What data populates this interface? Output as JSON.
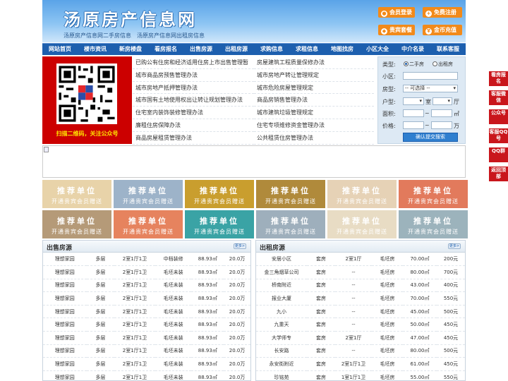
{
  "header": {
    "logo": "汤原房产信息网",
    "subtitle1": "汤原房产信息网二手房信息",
    "subtitle2": "汤原房产信息网出租房信息",
    "buttons": [
      "会员登录",
      "免费注册",
      "贵宾套餐",
      "金币充值"
    ]
  },
  "nav": [
    "网站首页",
    "楼市资讯",
    "新房楼盘",
    "看房报名",
    "出售房源",
    "出租房源",
    "求购信息",
    "求租信息",
    "地图找房",
    "小区大全",
    "中介名录",
    "联系客服"
  ],
  "qr": {
    "caption": "扫描二维码，关注公众号"
  },
  "news": {
    "left": [
      "已购公有住房和经济适用住房上市出售管理暂",
      "城市商品房预售管理办法",
      "城市房地产抵押管理办法",
      "城市国有土地使用权出让转让规划管理办法",
      "住宅室内装饰装修管理办法",
      "廉租住房保障办法",
      "商品房屋租赁管理办法"
    ],
    "right": [
      "房屋建筑工程质量保修办法",
      "城市房地产转让管理规定",
      "城市危险房屋管理规定",
      "商品房销售管理办法",
      "城市建筑垃圾管理规定",
      "住宅专项维修资金管理办法",
      "公共租赁住房管理办法"
    ]
  },
  "search": {
    "type_label": "类型:",
    "type_options": [
      "二手房",
      "出租房"
    ],
    "district_label": "小区:",
    "house_type_label": "房型:",
    "house_type_value": "-- 可选择 --",
    "layout_label": "户型:",
    "layout_unit1": "室",
    "layout_unit2": "厅",
    "area_label": "面积:",
    "range_sep": "~",
    "area_unit": "㎡",
    "price_label": "价格:",
    "price_unit": "万",
    "submit": "确认提交搜索"
  },
  "ads": {
    "title": "推荐单位",
    "sub": "开通贵宾会员赠送",
    "colors": [
      "#e8d3a9",
      "#9db3c9",
      "#c99e2e",
      "#b08a3b",
      "#e6d2b6",
      "#e27a5c",
      "#b59a78",
      "#e6835e",
      "#3aa3a5",
      "#9eafbc",
      "#e8dcc4",
      "#9cb3bc"
    ]
  },
  "sale": {
    "title": "出售房源",
    "more": "更多>",
    "rows": [
      [
        "理想家园",
        "多层",
        "2室1厅1卫",
        "中档装修",
        "88.93㎡",
        "20.0万"
      ],
      [
        "理想家园",
        "多层",
        "2室1厅1卫",
        "毛坯未装",
        "88.93㎡",
        "20.0万"
      ],
      [
        "理想家园",
        "多层",
        "2室1厅1卫",
        "毛坯未装",
        "88.93㎡",
        "20.0万"
      ],
      [
        "理想家园",
        "多层",
        "2室1厅1卫",
        "毛坯未装",
        "88.93㎡",
        "20.0万"
      ],
      [
        "理想家园",
        "多层",
        "2室1厅1卫",
        "毛坯未装",
        "88.93㎡",
        "20.0万"
      ],
      [
        "理想家园",
        "多层",
        "2室1厅1卫",
        "毛坯未装",
        "88.93㎡",
        "20.0万"
      ],
      [
        "理想家园",
        "多层",
        "2室1厅1卫",
        "毛坯未装",
        "88.93㎡",
        "20.0万"
      ],
      [
        "理想家园",
        "多层",
        "2室1厅1卫",
        "毛坯未装",
        "88.93㎡",
        "20.0万"
      ],
      [
        "理想家园",
        "多层",
        "2室1厅1卫",
        "毛坯未装",
        "88.93㎡",
        "20.0万"
      ],
      [
        "理想家园",
        "多层",
        "2室1厅1卫",
        "毛坯未装",
        "88.93㎡",
        "20.0万"
      ]
    ]
  },
  "rent": {
    "title": "出租房源",
    "more": "更多>",
    "rows": [
      [
        "安居小区",
        "套房",
        "2室1厅",
        "毛坯房",
        "70.00㎡",
        "200元"
      ],
      [
        "金三角烟草公司",
        "套房",
        "--",
        "毛坯房",
        "80.00㎡",
        "700元"
      ],
      [
        "桥南附近",
        "套房",
        "--",
        "毛坯房",
        "43.00㎡",
        "400元"
      ],
      [
        "报业大厦",
        "套房",
        "--",
        "毛坯房",
        "70.00㎡",
        "550元"
      ],
      [
        "九小",
        "套房",
        "--",
        "毛坯房",
        "45.00㎡",
        "500元"
      ],
      [
        "九重天",
        "套房",
        "--",
        "毛坯房",
        "50.00㎡",
        "450元"
      ],
      [
        "大学师专",
        "套房",
        "2室1厅",
        "毛坯房",
        "47.00㎡",
        "450元"
      ],
      [
        "长安路",
        "套房",
        "--",
        "毛坯房",
        "80.00㎡",
        "500元"
      ],
      [
        "永安街附近",
        "套房",
        "2室1厅1卫",
        "毛坯房",
        "61.00㎡",
        "450元"
      ],
      [
        "珍铭苑",
        "套房",
        "1室1厅1卫",
        "毛坯房",
        "55.00㎡",
        "550元"
      ]
    ]
  },
  "side": [
    "看房报名",
    "客服微信",
    "公众号",
    "客服QQ号",
    "QQ群",
    "返回顶部"
  ]
}
